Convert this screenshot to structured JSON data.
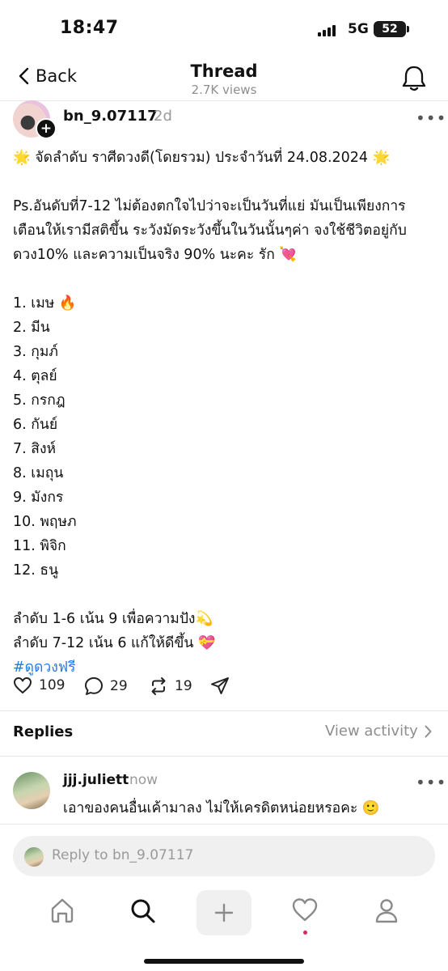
{
  "status_bar": {
    "time": "18:47",
    "network": "5G",
    "battery": "52"
  },
  "nav": {
    "back_label": "Back",
    "title": "Thread",
    "views": "2.7K views",
    "bell_icon": "bell-icon"
  },
  "post": {
    "username": "bn_9.07117",
    "time": "2d",
    "more": "•••",
    "lines": [
      "🌟 จัดลำดับ ราศีดวงดี(โดยรวม) ประจำวันที่ 24.08.2024 🌟",
      "",
      "Ps.อันดับที่7-12 ไม่ต้องตกใจไปว่าจะเป็นวันที่แย่ มันเป็นเพียงการ",
      "เตือนให้เรามีสติขึ้น ระวังมัดระวังขึ้นในวันนั้นๆค่า จงใช้ชีวิตอยู่กับ",
      "ดวง10% และความเป็นจริง 90% นะคะ รัก 💘",
      "",
      "1. เมษ 🔥",
      "2. มีน",
      "3. กุมภ์",
      "4. ตุลย์",
      "5. กรกฎ",
      "6. กันย์",
      "7. สิงห์",
      "8. เมถุน",
      "9. มังกร",
      "10. พฤษภ",
      "11. พิจิก",
      "12. ธนู",
      "",
      "ลำดับ 1-6 เน้น 9 เพื่อความปัง💫",
      "ลำดับ 7-12 เน้น 6 แก้ให้ดีขึ้น 💝"
    ],
    "hashtag": "#ดูดวงฟรี",
    "likes": "109",
    "comments": "29",
    "reposts": "19"
  },
  "replies_section": {
    "title": "Replies",
    "view_activity": "View activity"
  },
  "reply": {
    "username": "jjj.juliett",
    "time": "now",
    "more": "•••",
    "text": "เอาของคนอื่นเค้ามาลง ไม่ให้เครดิตหน่อยหรอคะ 🙂"
  },
  "reply_box": {
    "placeholder": "Reply to bn_9.07117"
  },
  "tabs": [
    "home-icon",
    "search-icon",
    "compose-icon",
    "activity-heart-icon",
    "profile-icon"
  ],
  "colors": {
    "hashtag": "#1d7bf0",
    "notification_dot": "#e0245e"
  }
}
